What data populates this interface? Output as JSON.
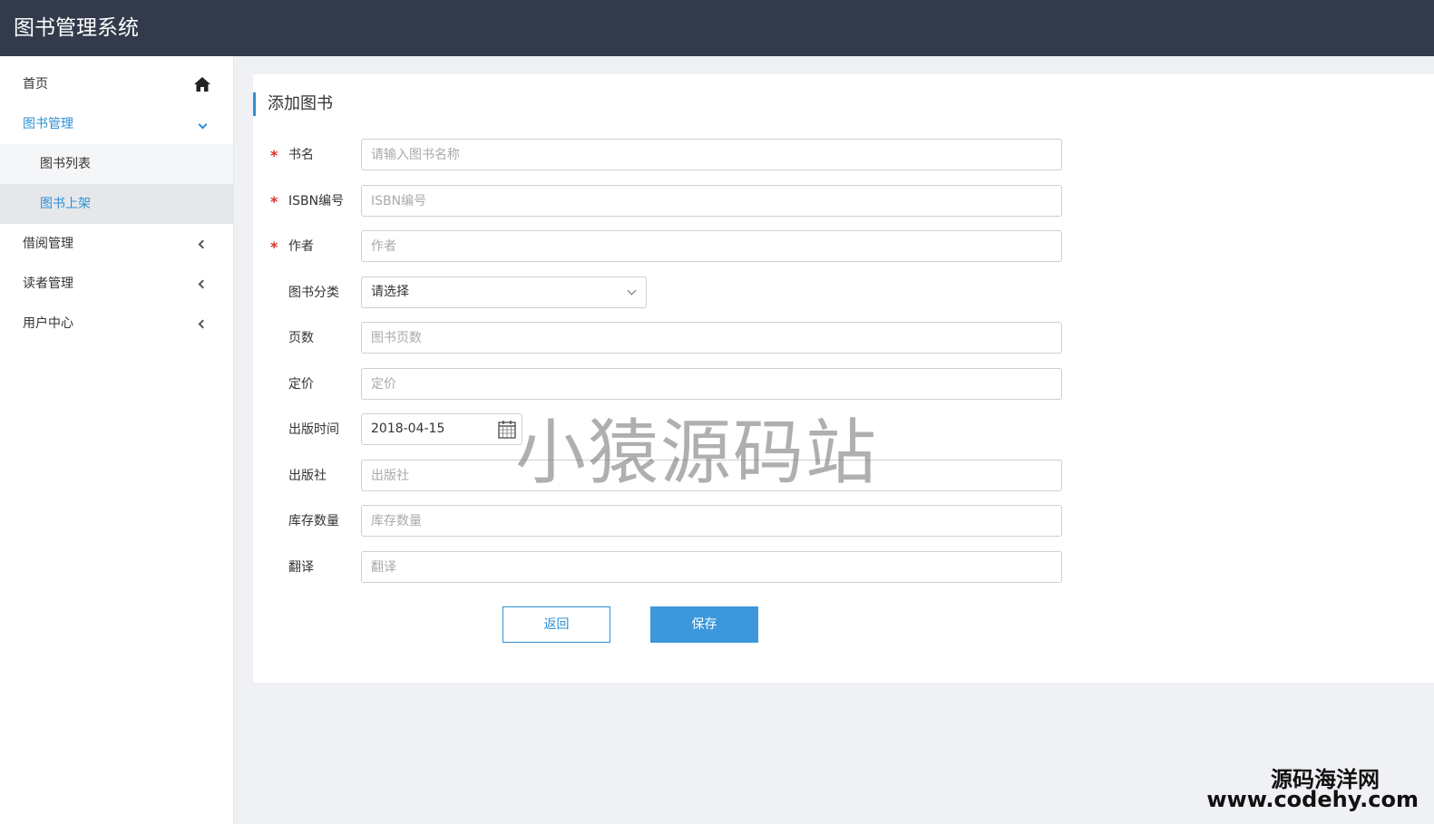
{
  "app": {
    "title": "图书管理系统"
  },
  "sidebar": {
    "home": "首页",
    "book_mgmt": "图书管理",
    "book_list": "图书列表",
    "book_add": "图书上架",
    "borrow_mgmt": "借阅管理",
    "reader_mgmt": "读者管理",
    "user_center": "用户中心"
  },
  "form": {
    "title": "添加图书",
    "name": {
      "label": "书名",
      "placeholder": "请输入图书名称",
      "required": "*"
    },
    "isbn": {
      "label": "ISBN编号",
      "placeholder": "ISBN编号",
      "required": "*"
    },
    "author": {
      "label": "作者",
      "placeholder": "作者",
      "required": "*"
    },
    "category": {
      "label": "图书分类",
      "value": "请选择"
    },
    "pages": {
      "label": "页数",
      "placeholder": "图书页数"
    },
    "price": {
      "label": "定价",
      "placeholder": "定价"
    },
    "pub_date": {
      "label": "出版时间",
      "value": "2018-04-15"
    },
    "publisher": {
      "label": "出版社",
      "placeholder": "出版社"
    },
    "stock": {
      "label": "库存数量",
      "placeholder": "库存数量"
    },
    "translator": {
      "label": "翻译",
      "placeholder": "翻译"
    }
  },
  "buttons": {
    "back": "返回",
    "save": "保存"
  },
  "watermark": {
    "center": "小猿源码站",
    "site": "源码海洋网",
    "url": "www.codehy.com"
  },
  "colors": {
    "topbar": "#323a4b",
    "accent": "#2d8fd6",
    "save_button": "#3c97dc",
    "required": "#d9302c"
  }
}
